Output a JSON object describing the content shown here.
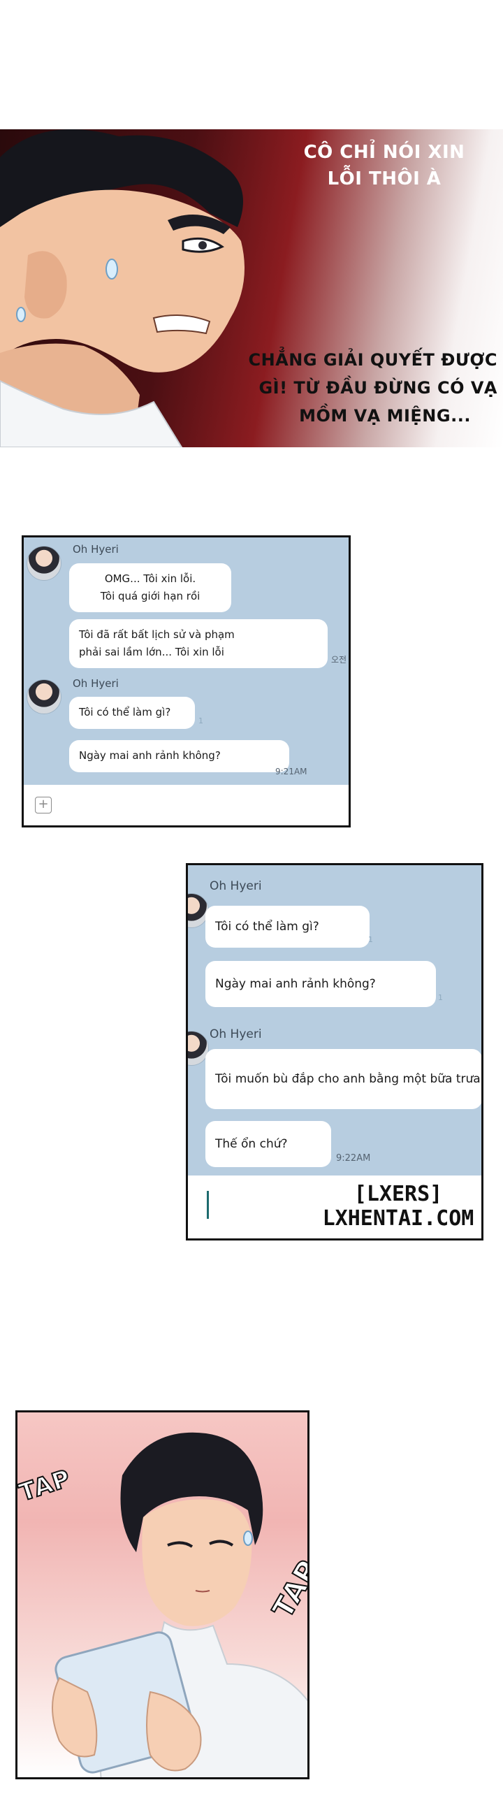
{
  "panel1": {
    "bubble_top": [
      "CÔ CHỈ NÓI XIN",
      "LỖI THÔI À"
    ],
    "bubble_bottom": [
      "CHẲNG GIẢI QUYẾT ĐƯỢC",
      "GÌ! TỪ ĐẦU ĐỪNG CÓ VẠ",
      "MỒM VẠ MIỆNG..."
    ]
  },
  "chat1": {
    "sender_1": "Oh Hyeri",
    "bubble_1": [
      "OMG... Tôi xin lỗi.",
      "Tôi quá giới hạn rồi"
    ],
    "bubble_2": [
      "Tôi đã rất bất lịch sử và phạm",
      "phải sai lầm lớn... Tôi xin lỗi"
    ],
    "time_partial": "오전",
    "sender_2": "Oh Hyeri",
    "bubble_3": "Tôi có thể làm gì?",
    "read_mark": "1",
    "bubble_4": "Ngày mai anh rảnh không?",
    "time": "9:21AM",
    "plus_icon": "+"
  },
  "chat2": {
    "sender_1": "Oh Hyeri",
    "bubble_1": "Tôi có thể làm gì?",
    "read_1": "1",
    "bubble_2": "Ngày mai anh rảnh không?",
    "read_2": "1",
    "sender_2": "Oh Hyeri",
    "bubble_3": "Tôi muốn bù đắp cho anh bằng một bữa trưa",
    "bubble_4": "Thế ổn chứ?",
    "time": "9:22AM"
  },
  "watermark": {
    "line1": "[LXERS]",
    "line2": "LXHENTAI.COM"
  },
  "panel4": {
    "sfx_1": "TAP",
    "sfx_2": "TAP"
  }
}
